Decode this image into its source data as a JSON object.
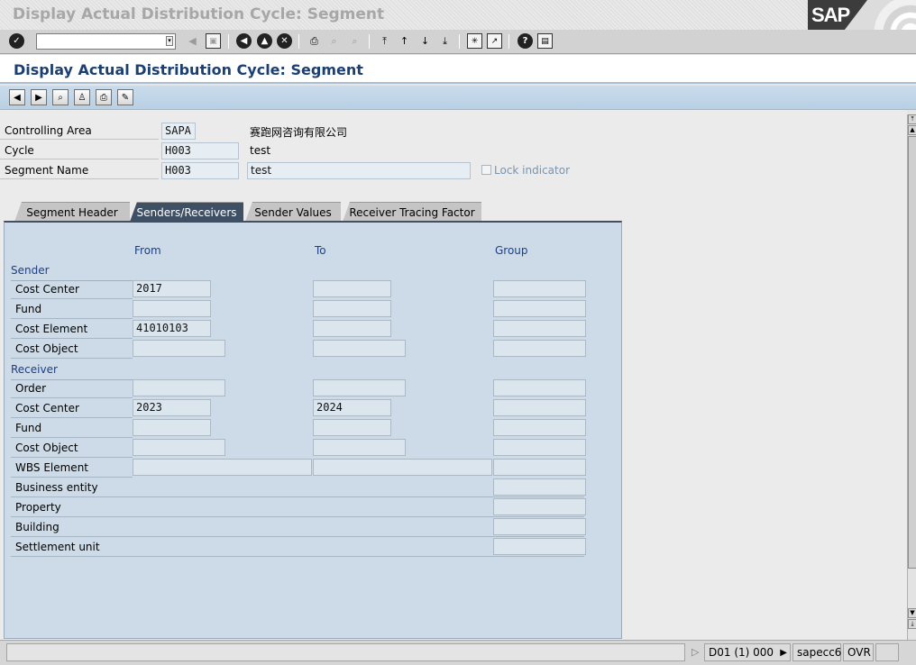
{
  "window": {
    "title": "Display Actual Distribution Cycle: Segment",
    "logo_text": "SAP"
  },
  "toolbar": {
    "command_value": "",
    "icons": [
      "enter-icon",
      "save-icon",
      "back-icon",
      "exit-icon",
      "cancel-icon",
      "print-icon",
      "find-icon",
      "find-next-icon",
      "first-page-icon",
      "previous-page-icon",
      "next-page-icon",
      "last-page-icon",
      "new-session-icon",
      "shortcut-icon",
      "help-icon",
      "customize-layout-icon"
    ]
  },
  "screen": {
    "title": "Display Actual Distribution Cycle: Segment"
  },
  "app_toolbar": {
    "icons": [
      "previous-segment-icon",
      "next-segment-icon",
      "find-icon",
      "segment-icon",
      "print-icon",
      "display-change-icon"
    ]
  },
  "header": {
    "controlling_area": {
      "label": "Controlling Area",
      "value": "SAPA",
      "text": "赛跑网咨询有限公司"
    },
    "cycle": {
      "label": "Cycle",
      "value": "H003",
      "text": "test"
    },
    "segment_name": {
      "label": "Segment Name",
      "value": "H003",
      "text": "test"
    },
    "lock_indicator": {
      "label": "Lock indicator",
      "checked": false
    }
  },
  "tabs": [
    {
      "label": "Segment Header",
      "active": false
    },
    {
      "label": "Senders/Receivers",
      "active": true
    },
    {
      "label": "Sender Values",
      "active": false
    },
    {
      "label": "Receiver Tracing Factor",
      "active": false
    }
  ],
  "panel": {
    "columns": {
      "from": "From",
      "to": "To",
      "group": "Group"
    },
    "sender": {
      "title": "Sender",
      "rows": [
        {
          "label": "Cost Center",
          "from": "2017",
          "to": "",
          "group": ""
        },
        {
          "label": "Fund",
          "from": "",
          "to": "",
          "group": ""
        },
        {
          "label": "Cost Element",
          "from": "41010103",
          "to": "",
          "group": ""
        },
        {
          "label": "Cost Object",
          "from": "",
          "to": "",
          "group": ""
        }
      ]
    },
    "receiver": {
      "title": "Receiver",
      "rows": [
        {
          "label": "Order",
          "from": "",
          "to": "",
          "group": ""
        },
        {
          "label": "Cost Center",
          "from": "2023",
          "to": "2024",
          "group": ""
        },
        {
          "label": "Fund",
          "from": "",
          "to": "",
          "group": ""
        },
        {
          "label": "Cost Object",
          "from": "",
          "to": "",
          "group": ""
        },
        {
          "label": "WBS Element",
          "from": "",
          "to": "",
          "group": ""
        },
        {
          "label": "Business entity",
          "group": ""
        },
        {
          "label": "Property",
          "group": ""
        },
        {
          "label": "Building",
          "group": ""
        },
        {
          "label": "Settlement unit",
          "group": ""
        }
      ]
    }
  },
  "status": {
    "message": "",
    "system": "D01 (1) 000",
    "server": "sapecc6",
    "mode": "OVR"
  }
}
